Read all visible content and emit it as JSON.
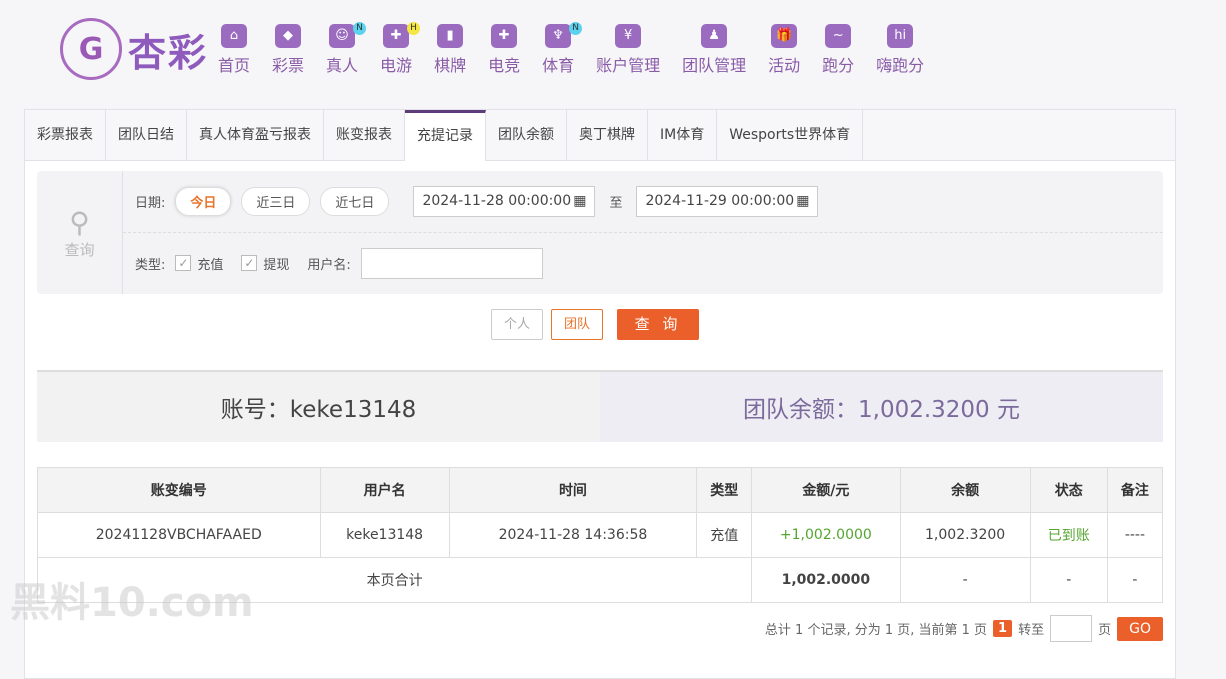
{
  "logo": {
    "text": "杏彩"
  },
  "nav": [
    {
      "label": "首页"
    },
    {
      "label": "彩票"
    },
    {
      "label": "真人",
      "badge": "N"
    },
    {
      "label": "电游",
      "badge": "H"
    },
    {
      "label": "棋牌"
    },
    {
      "label": "电竞"
    },
    {
      "label": "体育",
      "badge": "N"
    },
    {
      "label": "账户管理"
    },
    {
      "label": "团队管理"
    },
    {
      "label": "活动"
    },
    {
      "label": "跑分"
    },
    {
      "label": "嗨跑分"
    }
  ],
  "tabs": [
    "彩票报表",
    "团队日结",
    "真人体育盈亏报表",
    "账变报表",
    "充提记录",
    "团队余额",
    "奥丁棋牌",
    "IM体育",
    "Wesports世界体育"
  ],
  "filter": {
    "search_label": "查询",
    "date_label": "日期:",
    "quick": [
      "今日",
      "近三日",
      "近七日"
    ],
    "start": "2024-11-28 00:00:00",
    "to": "至",
    "end": "2024-11-29 00:00:00",
    "type_label": "类型:",
    "types": [
      "充值",
      "提现"
    ],
    "username_label": "用户名:",
    "username": ""
  },
  "buttons": {
    "personal": "个人",
    "team": "团队",
    "query": "查 询"
  },
  "summary": {
    "account": "账号：keke13148",
    "balance": "团队余额：1,002.3200 元"
  },
  "table": {
    "headers": [
      "账变编号",
      "用户名",
      "时间",
      "类型",
      "金额/元",
      "余额",
      "状态",
      "备注"
    ],
    "rows": [
      [
        "20241128VBCHAFAAED",
        "keke13148",
        "2024-11-28 14:36:58",
        "充值",
        "+1,002.0000",
        "1,002.3200",
        "已到账",
        "----"
      ]
    ],
    "total": {
      "label": "本页合计",
      "amount": "1,002.0000",
      "balance": "-",
      "status": "-",
      "note": "-"
    }
  },
  "pager": {
    "text": "总计 1 个记录, 分为 1 页, 当前第 1 页",
    "current": "1",
    "goto": "转至",
    "page": "页",
    "go": "GO"
  },
  "watermark": "黑料10.com",
  "colors": {
    "accent": "#ea5f2a",
    "brand": "#8e5bbd"
  }
}
